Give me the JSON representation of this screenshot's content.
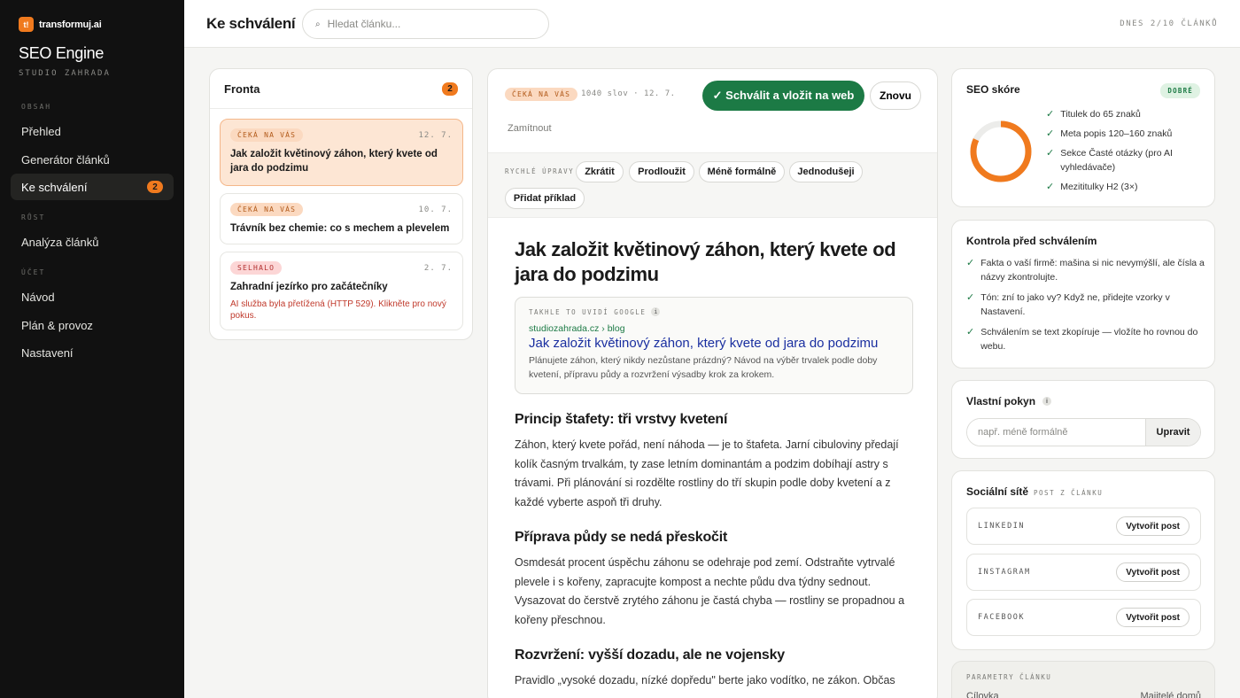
{
  "sidebar": {
    "brand": "transformuj.ai",
    "brand_logo": "t!",
    "app_title": "SEO Engine",
    "studio": "STUDIO ZAHRADA",
    "sections": [
      "OBSAH",
      "RŮST",
      "ÚČET"
    ],
    "items": [
      {
        "label": "Přehled"
      },
      {
        "label": "Generátor článků"
      },
      {
        "label": "Ke schválení",
        "badge": "2"
      },
      {
        "label": "Analýza článků"
      },
      {
        "label": "Návod"
      },
      {
        "label": "Plán & provoz"
      },
      {
        "label": "Nastavení"
      }
    ]
  },
  "header": {
    "title": "Ke schválení",
    "search_placeholder": "Hledat článku...",
    "search_icon": "search-icon",
    "right_text": "DNES 2/10 ČLÁNKŮ"
  },
  "queue": {
    "title": "Fronta",
    "count": "2",
    "items": [
      {
        "status": "ČEKÁ NA VÁS",
        "date": "12. 7.",
        "title": "Jak založit květinový záhon, který kvete od jara do podzimu",
        "error": ""
      },
      {
        "status": "ČEKÁ NA VÁS",
        "date": "10. 7.",
        "title": "Trávník bez chemie: co s mechem a plevelem",
        "error": ""
      },
      {
        "status": "SELHALO",
        "date": "2. 7.",
        "title": "Zahradní jezírko pro začátečníky",
        "error": "AI služba byla přetížená (HTTP 529). Klikněte pro nový pokus."
      }
    ]
  },
  "editor": {
    "status": "ČEKÁ NA VÁS",
    "meta": "1040 slov · 12. 7.",
    "approve_label": "✓ Schválit a vložit na web",
    "again_label": "Znovu",
    "reject_label": "Zamítnout",
    "quick_label": "RYCHLÉ ÚPRAVY",
    "chips": [
      "Zkrátit",
      "Prodloužit",
      "Méně formálně",
      "Jednodušeji",
      "Přidat příklad"
    ],
    "title": "Jak založit květinový záhon, který kvete od jara do podzimu",
    "serp": {
      "label": "TAKHLE TO UVIDÍ GOOGLE",
      "info": "i",
      "url": "studiozahrada.cz › blog",
      "title": "Jak založit květinový záhon, který kvete od jara do podzimu",
      "desc": "Plánujete záhon, který nikdy nezůstane prázdný? Návod na výběr trvalek podle doby kvetení, přípravu půdy a rozvržení výsadby krok za krokem."
    },
    "sections": [
      {
        "heading": "Princip štafety: tři vrstvy kvetení",
        "text": "Záhon, který kvete pořád, není náhoda — je to štafeta. Jarní cibuloviny předají kolík časným trvalkám, ty zase letním dominantám a podzim dobíhají astry s trávami. Při plánování si rozdělte rostliny do tří skupin podle doby kvetení a z každé vyberte aspoň tři druhy."
      },
      {
        "heading": "Příprava půdy se nedá přeskočit",
        "text": "Osmdesát procent úspěchu záhonu se odehraje pod zemí. Odstraňte vytrvalé plevele i s kořeny, zapracujte kompost a nechte půdu dva týdny sednout. Vysazovat do čerstvě zrytého záhonu je častá chyba — rostliny se propadnou a kořeny přeschnou."
      },
      {
        "heading": "Rozvržení: vyšší dozadu, ale ne vojensky",
        "text": "Pravidlo „vysoké dozadu, nízké dopředu\" berte jako vodítko, ne zákon. Občas"
      }
    ]
  },
  "seo": {
    "title": "SEO skóre",
    "badge": "DOBRÉ",
    "score_fraction": 0.82,
    "color_accent": "#f07a1e",
    "checks": [
      "Titulek do 65 znaků",
      "Meta popis 120–160 znaků",
      "Sekce Časté otázky (pro AI vyhledávače)",
      "Mezititulky H2 (3×)"
    ]
  },
  "control": {
    "title": "Kontrola před schválením",
    "checks": [
      "Fakta o vaší firmě: mašina si nic nevymýšlí, ale čísla a názvy zkontrolujte.",
      "Tón: zní to jako vy? Když ne, přidejte vzorky v Nastavení.",
      "Schválením se text zkopíruje — vložíte ho rovnou do webu."
    ]
  },
  "custom": {
    "title": "Vlastní pokyn",
    "info": "i",
    "placeholder": "např. méně formálně",
    "button": "Upravit"
  },
  "social": {
    "title": "Sociální sítě",
    "subtitle": "POST Z ČLÁNKU",
    "rows": [
      {
        "name": "LINKEDIN",
        "button": "Vytvořit post"
      },
      {
        "name": "INSTAGRAM",
        "button": "Vytvořit post"
      },
      {
        "name": "FACEBOOK",
        "button": "Vytvořit post"
      }
    ]
  },
  "params": {
    "label": "PARAMETRY ČLÁNKU",
    "key": "Cílovka",
    "value": "Majitelé domů"
  }
}
